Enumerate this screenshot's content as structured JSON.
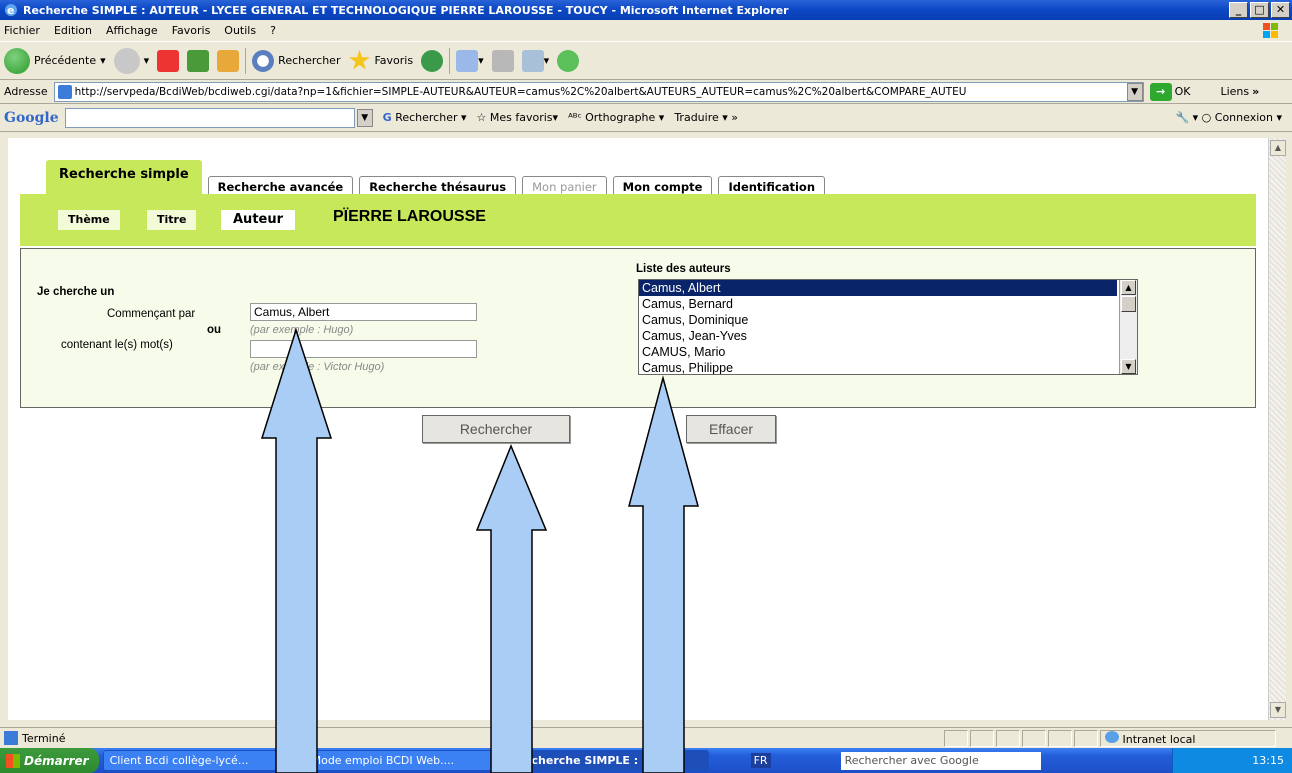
{
  "window": {
    "title": "Recherche SIMPLE : AUTEUR - LYCEE GENERAL ET TECHNOLOGIQUE PIERRE LAROUSSE - TOUCY - Microsoft Internet Explorer",
    "min": "_",
    "max": "□",
    "close": "✕"
  },
  "menu": [
    "Fichier",
    "Edition",
    "Affichage",
    "Favoris",
    "Outils",
    "?"
  ],
  "toolbar": {
    "back": "Précédente",
    "search": "Rechercher",
    "favorites": "Favoris"
  },
  "address": {
    "label": "Adresse",
    "url": "http://servpeda/BcdiWeb/bcdiweb.cgi/data?np=1&fichier=SIMPLE-AUTEUR&AUTEUR=camus%2C%20albert&AUTEURS_AUTEUR=camus%2C%20albert&COMPARE_AUTEU",
    "go": "OK",
    "links": "Liens"
  },
  "google": {
    "logo": "Google",
    "search": "Rechercher",
    "favorites": "Mes favoris",
    "spell": "Orthographe",
    "translate": "Traduire",
    "login": "Connexion"
  },
  "tabs": [
    {
      "label": "Recherche simple",
      "state": "active"
    },
    {
      "label": "Recherche avancée",
      "state": "normal"
    },
    {
      "label": "Recherche thésaurus",
      "state": "normal"
    },
    {
      "label": "Mon panier",
      "state": "disabled"
    },
    {
      "label": "Mon compte",
      "state": "normal"
    },
    {
      "label": "Identification",
      "state": "normal"
    }
  ],
  "subtabs": {
    "theme": "Thème",
    "titre": "Titre",
    "auteur": "Auteur"
  },
  "school": "PÏERRE LAROUSSE",
  "form": {
    "heading": "Je cherche un",
    "starts_label": "Commençant par",
    "ou": "ou",
    "contains_label": "contenant le(s) mot(s)",
    "starts_value": "Camus, Albert",
    "starts_hint": "(par exemple : Hugo)",
    "contains_value": "",
    "contains_hint": "(par exemple : Victor Hugo)",
    "list_title": "Liste des auteurs",
    "authors": [
      "Camus, Albert",
      "Camus, Bernard",
      "Camus, Dominique",
      "Camus, Jean-Yves",
      "CAMUS, Mario",
      "Camus, Philippe"
    ],
    "selected_index": 0,
    "search_btn": "Rechercher",
    "clear_btn": "Effacer"
  },
  "status": {
    "text": "Terminé",
    "zone": "Intranet local"
  },
  "taskbar": {
    "start": "Démarrer",
    "tasks": [
      "Client Bcdi collège-lycé...",
      "Mode emploi BCDI Web....",
      "Recherche SIMPLE : ..."
    ],
    "lang": "FR",
    "search_placeholder": "Rechercher avec Google",
    "clock": "13:15"
  },
  "colors": {
    "accent_green": "#c8e85c",
    "arrow_fill": "#a9cdf5"
  }
}
